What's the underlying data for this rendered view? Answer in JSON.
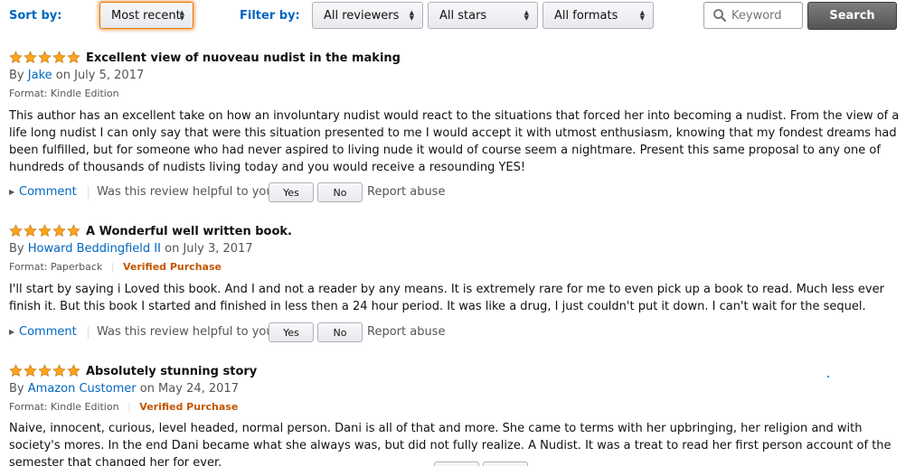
{
  "toolbar": {
    "sort_label": "Sort by:",
    "sort_value": "Most recent",
    "filter_label": "Filter by:",
    "reviewers_value": "All reviewers",
    "stars_value": "All stars",
    "formats_value": "All formats",
    "keyword_placeholder": "Keyword",
    "search_label": "Search"
  },
  "colors": {
    "link": "#0066c0",
    "star": "#ffa41c",
    "verified": "#c45500"
  },
  "reviews": [
    {
      "rating": 5,
      "title": "Excellent view of nuoveau nudist in the making",
      "by": "By",
      "author": "Jake",
      "date": "on July 5, 2017",
      "format": "Format: Kindle Edition",
      "verified": "",
      "body": "This author has an excellent take on how an involuntary nudist would react to the situations that forced her into becoming a nudist. From the view of a life long nudist I can only say that were this situation presented to me I would accept it with utmost enthusiasm, knowing that my fondest dreams had been fulfilled, but for someone who had never aspired to living nude it would of course seem a nightmare. Present this same proposal to any one of hundreds of thousands of nudists living today and you would receive a resounding YES!"
    },
    {
      "rating": 5,
      "title": "A Wonderful well written book.",
      "by": "By",
      "author": "Howard Beddingfield II",
      "date": "on July 3, 2017",
      "format": "Format: Paperback",
      "verified": "Verified Purchase",
      "body": "I'll start by saying i Loved this book. And I and not a reader by any means. It is extremely rare for me to even pick up a book to read. Much less ever finish it. But this book I started and finished in less then a 24 hour period. It was like a drug, I just couldn't put it down. I can't wait for the sequel."
    },
    {
      "rating": 5,
      "title": "Absolutely stunning story",
      "by": "By",
      "author": "Amazon Customer",
      "date": "on May 24, 2017",
      "format": "Format: Kindle Edition",
      "verified": "Verified Purchase",
      "body": "Naive, innocent, curious, level headed, normal person. Dani is all of that and more. She came to terms with her upbringing, her religion and with society's mores. In the end Dani became what she always was, but did not fully realize. A Nudist. It was a treat to read her first person account of the semester that changed her for ever."
    }
  ],
  "actions": {
    "comment": "Comment",
    "helpful_question": "Was this review helpful to you?",
    "yes": "Yes",
    "no": "No",
    "report": "Report abuse"
  }
}
